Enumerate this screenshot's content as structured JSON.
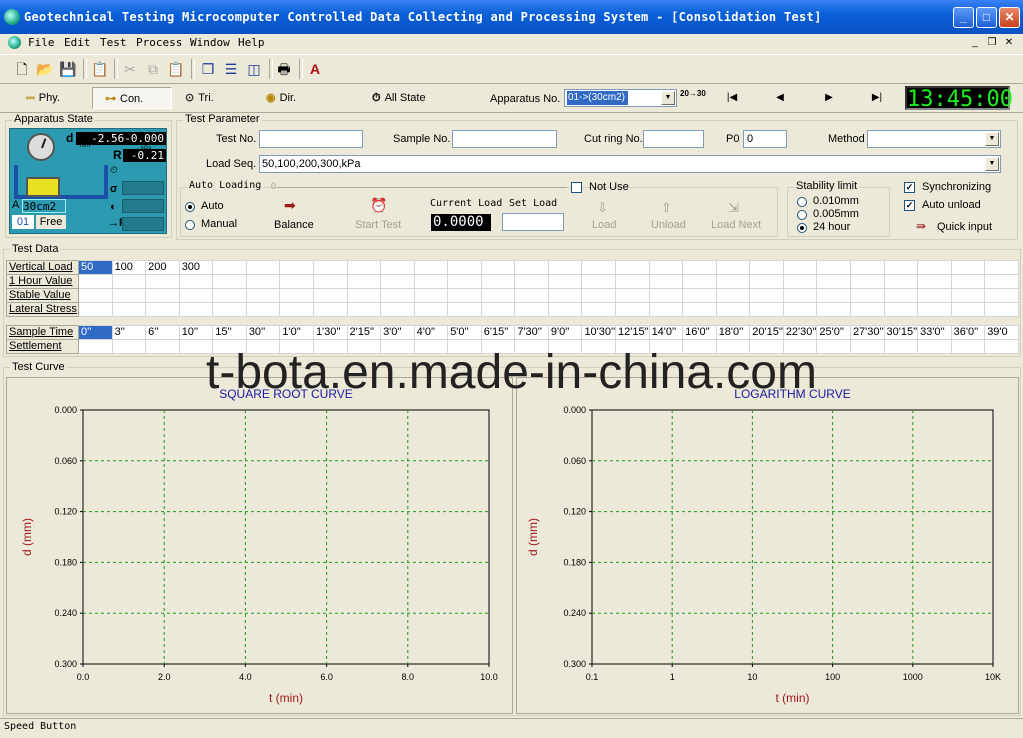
{
  "window": {
    "title": "Geotechnical Testing Microcomputer Controlled Data Collecting and Processing System - [Consolidation Test]",
    "buttons": {
      "minimize": "_",
      "maximize": "□",
      "close": "✕"
    }
  },
  "menu": {
    "items": [
      "File",
      "Edit",
      "Test",
      "Process",
      "Window",
      "Help"
    ],
    "mdi": {
      "minimize": "_",
      "restore": "❐",
      "close": "✕"
    }
  },
  "toolbar": {
    "icons": [
      "new-icon",
      "open-icon",
      "save-icon",
      "properties-icon",
      "cut-icon",
      "copy-icon",
      "paste-icon",
      "cascade-icon",
      "tile-horizontal-icon",
      "tile-vertical-icon",
      "print-icon",
      "font-icon"
    ]
  },
  "speedbar": {
    "buttons": [
      "Phy.",
      "Con.",
      "Tri.",
      "Dir."
    ],
    "all_state": "All State",
    "apparatus_label": "Apparatus No.",
    "apparatus_value": "01->(30cm2)",
    "badge": "20→30",
    "nav": [
      "|◀",
      "◀",
      "▶",
      "▶|"
    ],
    "clock": "13:45:00"
  },
  "apparatus": {
    "title": "Apparatus State",
    "d_label": "d",
    "d_unit": "mm",
    "d_value": "-2.56-0.000",
    "kpa_unit": "kPa",
    "r_label": "R",
    "r_value": "-0.21",
    "area_label": "A",
    "area_value": "30cm2",
    "number": "01",
    "status": "Free",
    "p_label": "→P",
    "sigma_label": "σ"
  },
  "test_parameter": {
    "title": "Test Parameter",
    "test_no_label": "Test No.",
    "test_no": "",
    "sample_no_label": "Sample No.",
    "sample_no": "",
    "cut_ring_label": "Cut ring No.",
    "cut_ring": "",
    "p0_label": "P0",
    "p0": "0",
    "method_label": "Method",
    "method": "",
    "load_seq_label": "Load Seq.",
    "load_seq": "50,100,200,300,kPa"
  },
  "auto_loading": {
    "title": "Auto Loading",
    "slider_value": "0",
    "auto": "Auto",
    "manual": "Manual",
    "balance": "Balance",
    "start_test": "Start Test",
    "current_load_label": "Current Load",
    "set_load_label": "Set Load",
    "current_load": "0.0000",
    "set_load": "",
    "not_use": "Not Use",
    "load": "Load",
    "unload": "Unload",
    "load_next": "Load Next"
  },
  "stability": {
    "title": "Stability limit",
    "options": [
      "0.010mm",
      "0.005mm",
      "24 hour"
    ],
    "selected": 2
  },
  "options": {
    "synchronizing": "Synchronizing",
    "auto_unload": "Auto unload",
    "quick_input": "Quick input"
  },
  "test_data": {
    "title": "Test Data",
    "load_rows": [
      "Vertical Load",
      "1 Hour Value",
      "Stable  Value",
      "Lateral Stress"
    ],
    "loads": [
      "50",
      "100",
      "200",
      "300"
    ],
    "load_columns": 28,
    "time_rows": [
      "Sample Time",
      "Settlement"
    ],
    "times": [
      "0''",
      "3''",
      "6''",
      "10''",
      "15''",
      "30''",
      "1'0''",
      "1'30''",
      "2'15''",
      "3'0''",
      "4'0''",
      "5'0''",
      "6'15''",
      "7'30''",
      "9'0''",
      "10'30''",
      "12'15''",
      "14'0''",
      "16'0''",
      "18'0''",
      "20'15''",
      "22'30''",
      "25'0''",
      "27'30''",
      "30'15''",
      "33'0''",
      "36'0''",
      "39'0"
    ]
  },
  "test_curve": {
    "title": "Test Curve"
  },
  "chart_data": [
    {
      "type": "line",
      "title": "SQUARE ROOT CURVE",
      "xlabel": "t (min)",
      "ylabel": "d (mm)",
      "xlim": [
        0,
        10
      ],
      "ylim": [
        0.3,
        0
      ],
      "x_ticks": [
        "0.0",
        "2.0",
        "4.0",
        "6.0",
        "8.0",
        "10.0"
      ],
      "y_ticks": [
        "0.000",
        "0.060",
        "0.120",
        "0.180",
        "0.240",
        "0.300"
      ],
      "grid": true,
      "series": []
    },
    {
      "type": "line",
      "title": "LOGARITHM CURVE",
      "xlabel": "t (min)",
      "ylabel": "d (mm)",
      "x_scale": "log",
      "xlim": [
        0.1,
        10000
      ],
      "ylim": [
        0.3,
        0
      ],
      "x_ticks": [
        "0.1",
        "1",
        "10",
        "100",
        "1000",
        "10K"
      ],
      "y_ticks": [
        "0.000",
        "0.060",
        "0.120",
        "0.180",
        "0.240",
        "0.300"
      ],
      "grid": true,
      "series": []
    }
  ],
  "watermark": "t-bota.en.made-in-china.com",
  "status": "Speed Button"
}
